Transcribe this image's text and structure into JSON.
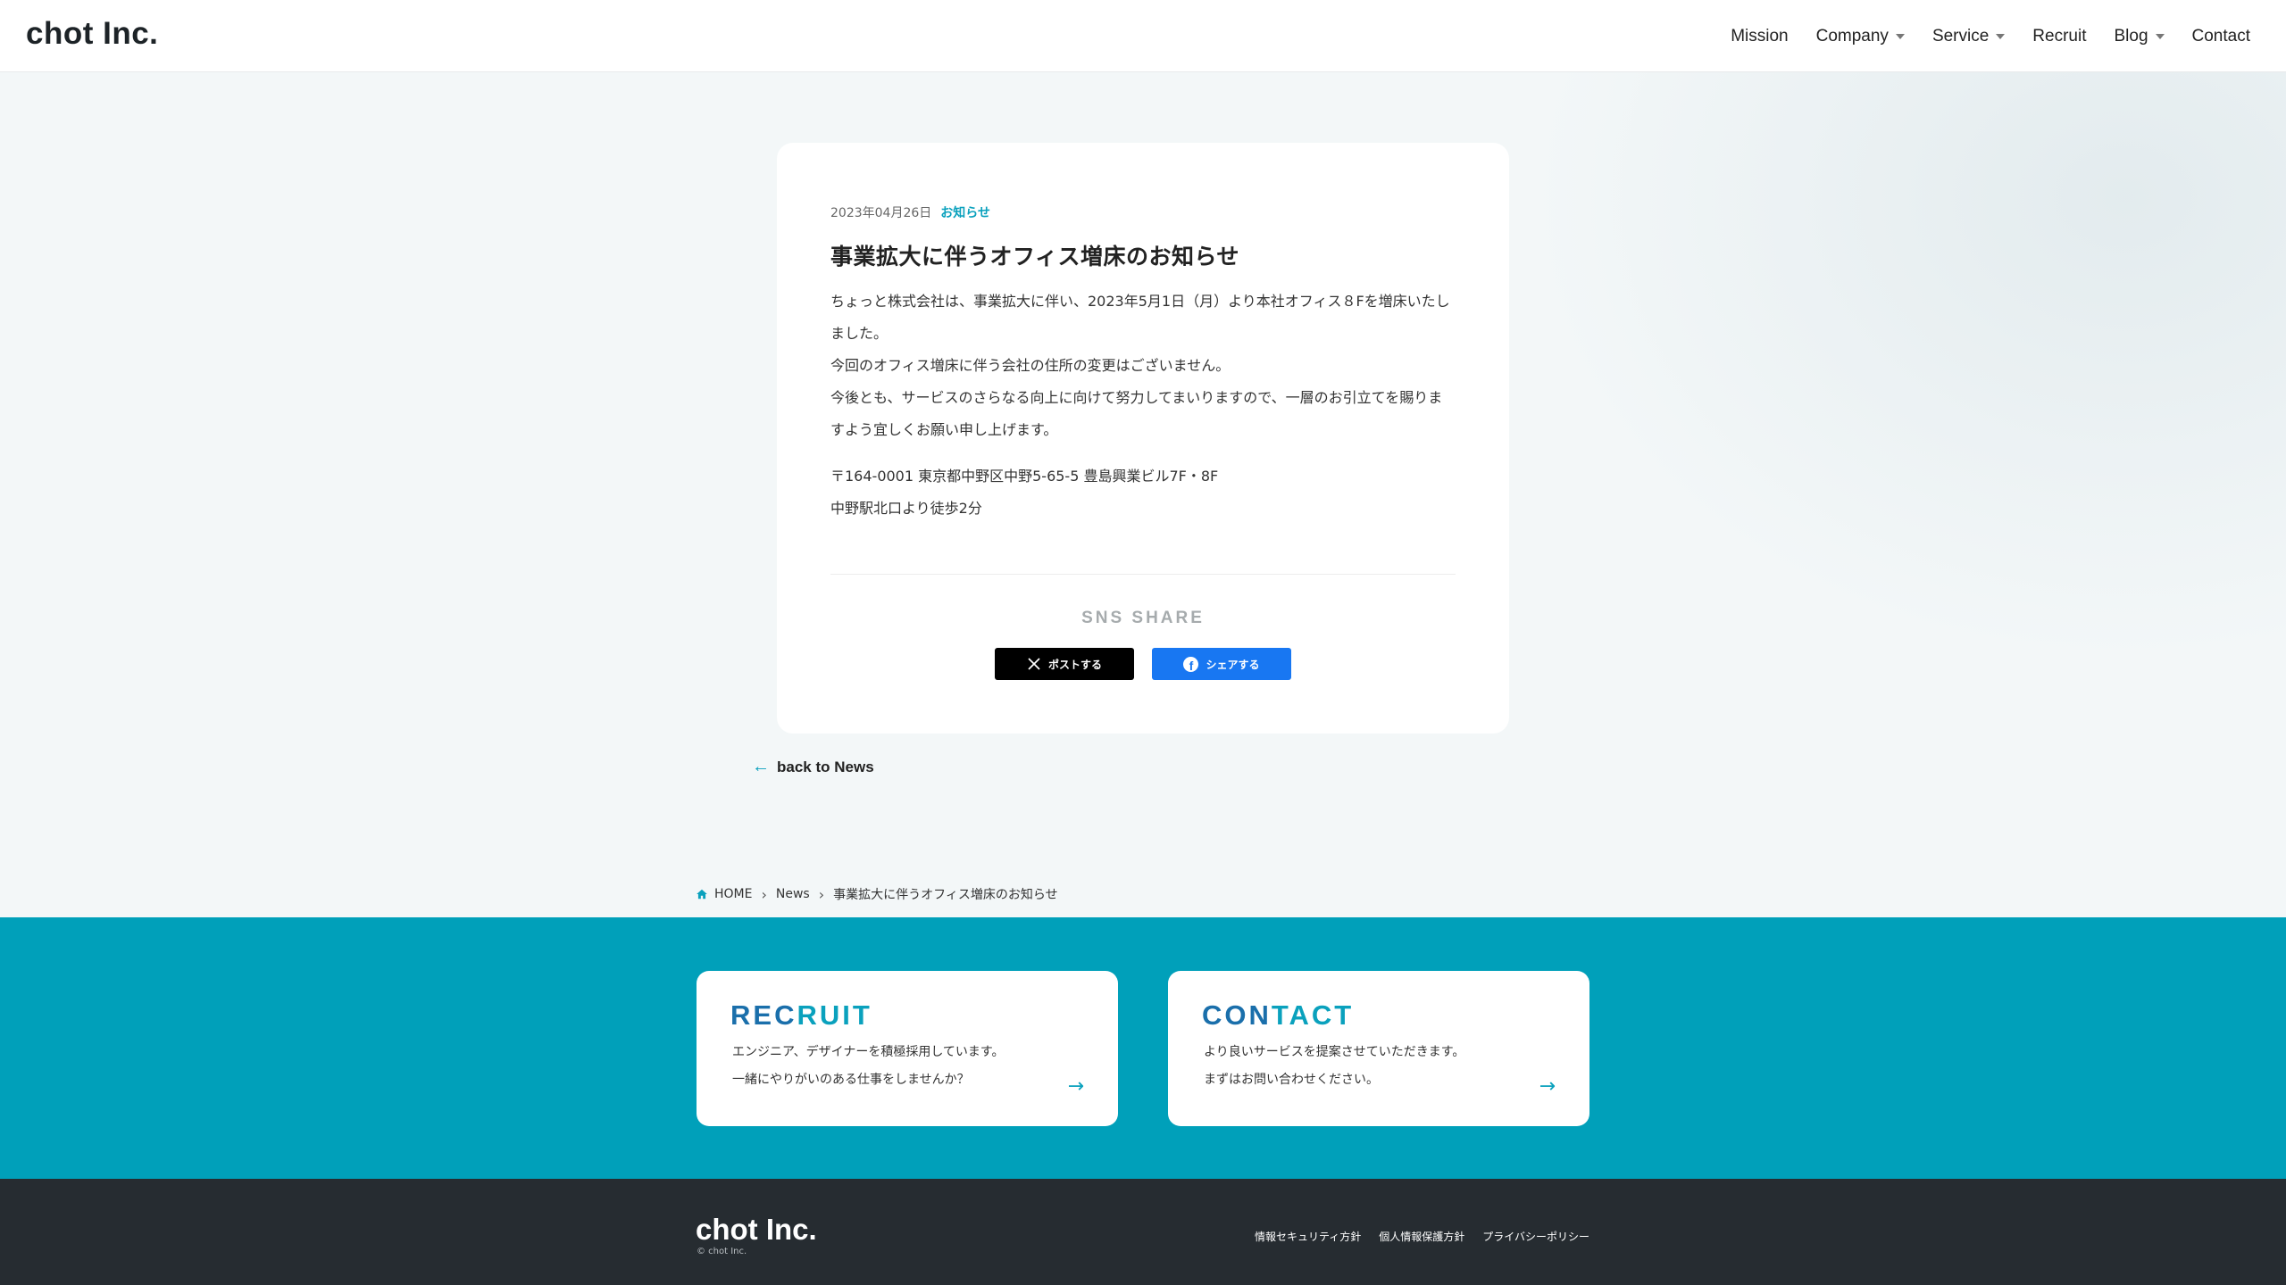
{
  "header": {
    "logo": "chot Inc.",
    "nav": [
      {
        "label": "Mission",
        "dropdown": false
      },
      {
        "label": "Company",
        "dropdown": true
      },
      {
        "label": "Service",
        "dropdown": true
      },
      {
        "label": "Recruit",
        "dropdown": false
      },
      {
        "label": "Blog",
        "dropdown": true
      },
      {
        "label": "Contact",
        "dropdown": false
      }
    ]
  },
  "article": {
    "date": "2023年04月26日",
    "category": "お知らせ",
    "title": "事業拡大に伴うオフィス増床のお知らせ",
    "paragraphs": [
      "ちょっと株式会社は、事業拡大に伴い、2023年5月1日（月）より本社オフィス８Fを増床いたしました。",
      "今回のオフィス増床に伴う会社の住所の変更はございません。",
      "今後とも、サービスのさらなる向上に向けて努力してまいりますので、一層のお引立てを賜りますよう宜しくお願い申し上げます。"
    ],
    "address_line1": "〒164-0001 東京都中野区中野5-65-5 豊島興業ビル7F・8F",
    "address_line2": "中野駅北口より徒歩2分",
    "sns_title": "SNS SHARE",
    "share_x_label": "ポストする",
    "share_fb_label": "シェアする"
  },
  "back_link": "back to News",
  "breadcrumb": {
    "home": "HOME",
    "news": "News",
    "current": "事業拡大に伴うオフィス増床のお知らせ"
  },
  "cta": {
    "recruit": {
      "title_a": "REC",
      "title_b": "RUIT",
      "line1": "エンジニア、デザイナーを積極採用しています。",
      "line2": "一緒にやりがいのある仕事をしませんか？"
    },
    "contact": {
      "title_a": "CON",
      "title_b": "TACT",
      "line1": "より良いサービスを提案させていただきます。",
      "line2": "まずはお問い合わせください。"
    }
  },
  "footer": {
    "logo": "chot Inc.",
    "copyright": "© chot Inc.",
    "links": [
      "情報セキュリティ方針",
      "個人情報保護方針",
      "プライバシーポリシー"
    ]
  },
  "colors": {
    "accent": "#0aa1bd",
    "band": "#00a0ba",
    "footer_bg": "#262c31",
    "x_button": "#000000",
    "fb_button": "#1877f2"
  },
  "icons": [
    "x-logo-icon",
    "facebook-icon",
    "arrow-left-icon",
    "home-icon",
    "chevron-right-icon",
    "arrow-right-icon",
    "caret-down-icon"
  ]
}
